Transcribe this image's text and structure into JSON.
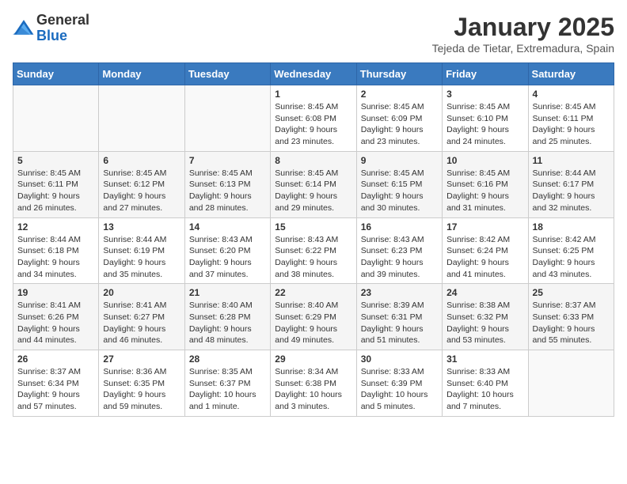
{
  "header": {
    "logo_line1": "General",
    "logo_line2": "Blue",
    "title": "January 2025",
    "subtitle": "Tejeda de Tietar, Extremadura, Spain"
  },
  "weekdays": [
    "Sunday",
    "Monday",
    "Tuesday",
    "Wednesday",
    "Thursday",
    "Friday",
    "Saturday"
  ],
  "weeks": [
    [
      {
        "day": "",
        "info": ""
      },
      {
        "day": "",
        "info": ""
      },
      {
        "day": "",
        "info": ""
      },
      {
        "day": "1",
        "info": "Sunrise: 8:45 AM\nSunset: 6:08 PM\nDaylight: 9 hours and 23 minutes."
      },
      {
        "day": "2",
        "info": "Sunrise: 8:45 AM\nSunset: 6:09 PM\nDaylight: 9 hours and 23 minutes."
      },
      {
        "day": "3",
        "info": "Sunrise: 8:45 AM\nSunset: 6:10 PM\nDaylight: 9 hours and 24 minutes."
      },
      {
        "day": "4",
        "info": "Sunrise: 8:45 AM\nSunset: 6:11 PM\nDaylight: 9 hours and 25 minutes."
      }
    ],
    [
      {
        "day": "5",
        "info": "Sunrise: 8:45 AM\nSunset: 6:11 PM\nDaylight: 9 hours and 26 minutes."
      },
      {
        "day": "6",
        "info": "Sunrise: 8:45 AM\nSunset: 6:12 PM\nDaylight: 9 hours and 27 minutes."
      },
      {
        "day": "7",
        "info": "Sunrise: 8:45 AM\nSunset: 6:13 PM\nDaylight: 9 hours and 28 minutes."
      },
      {
        "day": "8",
        "info": "Sunrise: 8:45 AM\nSunset: 6:14 PM\nDaylight: 9 hours and 29 minutes."
      },
      {
        "day": "9",
        "info": "Sunrise: 8:45 AM\nSunset: 6:15 PM\nDaylight: 9 hours and 30 minutes."
      },
      {
        "day": "10",
        "info": "Sunrise: 8:45 AM\nSunset: 6:16 PM\nDaylight: 9 hours and 31 minutes."
      },
      {
        "day": "11",
        "info": "Sunrise: 8:44 AM\nSunset: 6:17 PM\nDaylight: 9 hours and 32 minutes."
      }
    ],
    [
      {
        "day": "12",
        "info": "Sunrise: 8:44 AM\nSunset: 6:18 PM\nDaylight: 9 hours and 34 minutes."
      },
      {
        "day": "13",
        "info": "Sunrise: 8:44 AM\nSunset: 6:19 PM\nDaylight: 9 hours and 35 minutes."
      },
      {
        "day": "14",
        "info": "Sunrise: 8:43 AM\nSunset: 6:20 PM\nDaylight: 9 hours and 37 minutes."
      },
      {
        "day": "15",
        "info": "Sunrise: 8:43 AM\nSunset: 6:22 PM\nDaylight: 9 hours and 38 minutes."
      },
      {
        "day": "16",
        "info": "Sunrise: 8:43 AM\nSunset: 6:23 PM\nDaylight: 9 hours and 39 minutes."
      },
      {
        "day": "17",
        "info": "Sunrise: 8:42 AM\nSunset: 6:24 PM\nDaylight: 9 hours and 41 minutes."
      },
      {
        "day": "18",
        "info": "Sunrise: 8:42 AM\nSunset: 6:25 PM\nDaylight: 9 hours and 43 minutes."
      }
    ],
    [
      {
        "day": "19",
        "info": "Sunrise: 8:41 AM\nSunset: 6:26 PM\nDaylight: 9 hours and 44 minutes."
      },
      {
        "day": "20",
        "info": "Sunrise: 8:41 AM\nSunset: 6:27 PM\nDaylight: 9 hours and 46 minutes."
      },
      {
        "day": "21",
        "info": "Sunrise: 8:40 AM\nSunset: 6:28 PM\nDaylight: 9 hours and 48 minutes."
      },
      {
        "day": "22",
        "info": "Sunrise: 8:40 AM\nSunset: 6:29 PM\nDaylight: 9 hours and 49 minutes."
      },
      {
        "day": "23",
        "info": "Sunrise: 8:39 AM\nSunset: 6:31 PM\nDaylight: 9 hours and 51 minutes."
      },
      {
        "day": "24",
        "info": "Sunrise: 8:38 AM\nSunset: 6:32 PM\nDaylight: 9 hours and 53 minutes."
      },
      {
        "day": "25",
        "info": "Sunrise: 8:37 AM\nSunset: 6:33 PM\nDaylight: 9 hours and 55 minutes."
      }
    ],
    [
      {
        "day": "26",
        "info": "Sunrise: 8:37 AM\nSunset: 6:34 PM\nDaylight: 9 hours and 57 minutes."
      },
      {
        "day": "27",
        "info": "Sunrise: 8:36 AM\nSunset: 6:35 PM\nDaylight: 9 hours and 59 minutes."
      },
      {
        "day": "28",
        "info": "Sunrise: 8:35 AM\nSunset: 6:37 PM\nDaylight: 10 hours and 1 minute."
      },
      {
        "day": "29",
        "info": "Sunrise: 8:34 AM\nSunset: 6:38 PM\nDaylight: 10 hours and 3 minutes."
      },
      {
        "day": "30",
        "info": "Sunrise: 8:33 AM\nSunset: 6:39 PM\nDaylight: 10 hours and 5 minutes."
      },
      {
        "day": "31",
        "info": "Sunrise: 8:33 AM\nSunset: 6:40 PM\nDaylight: 10 hours and 7 minutes."
      },
      {
        "day": "",
        "info": ""
      }
    ]
  ]
}
